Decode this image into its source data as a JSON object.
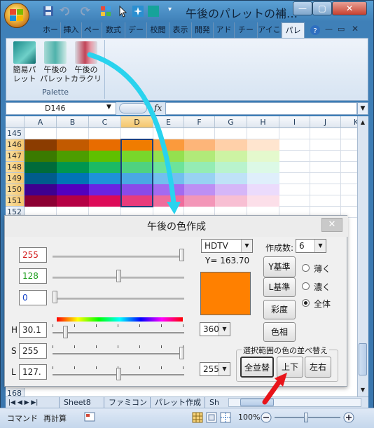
{
  "window": {
    "title": "午後のパレットの補…",
    "minimize": "—",
    "maximize": "▢",
    "close": "✕"
  },
  "ribbon": {
    "tabs": [
      "ホー",
      "挿入",
      "ペー",
      "数式",
      "デー",
      "校閲",
      "表示",
      "開発",
      "アド",
      "チー",
      "アイこ",
      "パレ"
    ],
    "active_tab": "パレ",
    "group_label": "Palette",
    "buttons": [
      {
        "label": "簡易パ\nレット"
      },
      {
        "label": "午後の\nパレット"
      },
      {
        "label": "午後の\nカラクリ"
      }
    ]
  },
  "formula_bar": {
    "name_box": "D146",
    "fx": "fx"
  },
  "sheet": {
    "columns": [
      "A",
      "B",
      "C",
      "D",
      "E",
      "F",
      "G",
      "H",
      "I",
      "J",
      "K"
    ],
    "selected_column": "D",
    "rows": [
      "145",
      "146",
      "147",
      "148",
      "149",
      "150",
      "151",
      "152",
      "168"
    ],
    "selected_rows": [
      "146",
      "147",
      "148",
      "149",
      "150",
      "151"
    ],
    "color_rows": [
      [
        "#8b3c00",
        "#c25a00",
        "#e86c00",
        "#f07c00",
        "#fb9a3c",
        "#fdb579",
        "#ffd0a9",
        "#ffe5cf"
      ],
      [
        "#3a7a00",
        "#4c9d00",
        "#5fc000",
        "#78d72b",
        "#94e04f",
        "#b1ea79",
        "#cdf3a3",
        "#e4f9cd"
      ],
      [
        "#006b3a",
        "#00964e",
        "#1cba64",
        "#4fd280",
        "#6de39a",
        "#94ecb4",
        "#b9f3cd",
        "#dcf9e6"
      ],
      [
        "#005c8c",
        "#0074b5",
        "#1e92d8",
        "#4aa8e3",
        "#72bfee",
        "#98d2f2",
        "#bfe2f7",
        "#dfeffb"
      ],
      [
        "#3f0090",
        "#5300bf",
        "#6a23e3",
        "#8a4ae9",
        "#a46af0",
        "#bd8ff4",
        "#d5b6f8",
        "#ebdbfc"
      ],
      [
        "#8c0033",
        "#b50044",
        "#dd0a58",
        "#e83c7c",
        "#ef6c9c",
        "#f396b8",
        "#f8bfd3",
        "#fcdfe9"
      ]
    ],
    "sheet_tabs": [
      "Sheet8",
      "ファミコン",
      "パレット作成",
      "Sh"
    ],
    "status": {
      "mode": "コマンド",
      "calc": "再計算",
      "zoom": "100%"
    }
  },
  "dialog": {
    "title": "午後の色作成",
    "close": "✕",
    "rgb": {
      "r": "255",
      "g": "128",
      "b": "0"
    },
    "rgb_levels": {
      "r": 1.0,
      "g": 0.502,
      "b": 0.0
    },
    "hsl": {
      "h_label": "H",
      "h_value": "30.1",
      "h_combo": "360",
      "s_label": "S",
      "s_value": "255",
      "l_label": "L",
      "l_value": "127.",
      "l_combo": "255"
    },
    "hsl_levels": {
      "h": 0.084,
      "s": 1.0,
      "l": 0.5
    },
    "standard": "HDTV",
    "y_value": "Y=  163.70",
    "swatch_color": "#ff8000",
    "count_label": "作成数:",
    "count_value": "6",
    "buttons": {
      "y_std": "Y基準",
      "l_std": "L基準",
      "saturation": "彩度",
      "hue": "色相"
    },
    "radios": [
      {
        "label": "薄く",
        "checked": false
      },
      {
        "label": "濃く",
        "checked": false
      },
      {
        "label": "全体",
        "checked": true
      }
    ],
    "sort_group": {
      "title": "選択範囲の色の並べ替え",
      "all": "全並替",
      "vertical": "上下",
      "horizontal": "左右"
    }
  },
  "colors": {
    "annotation_arrow": "#29d3ee",
    "red_arrow": "#e8141a"
  }
}
